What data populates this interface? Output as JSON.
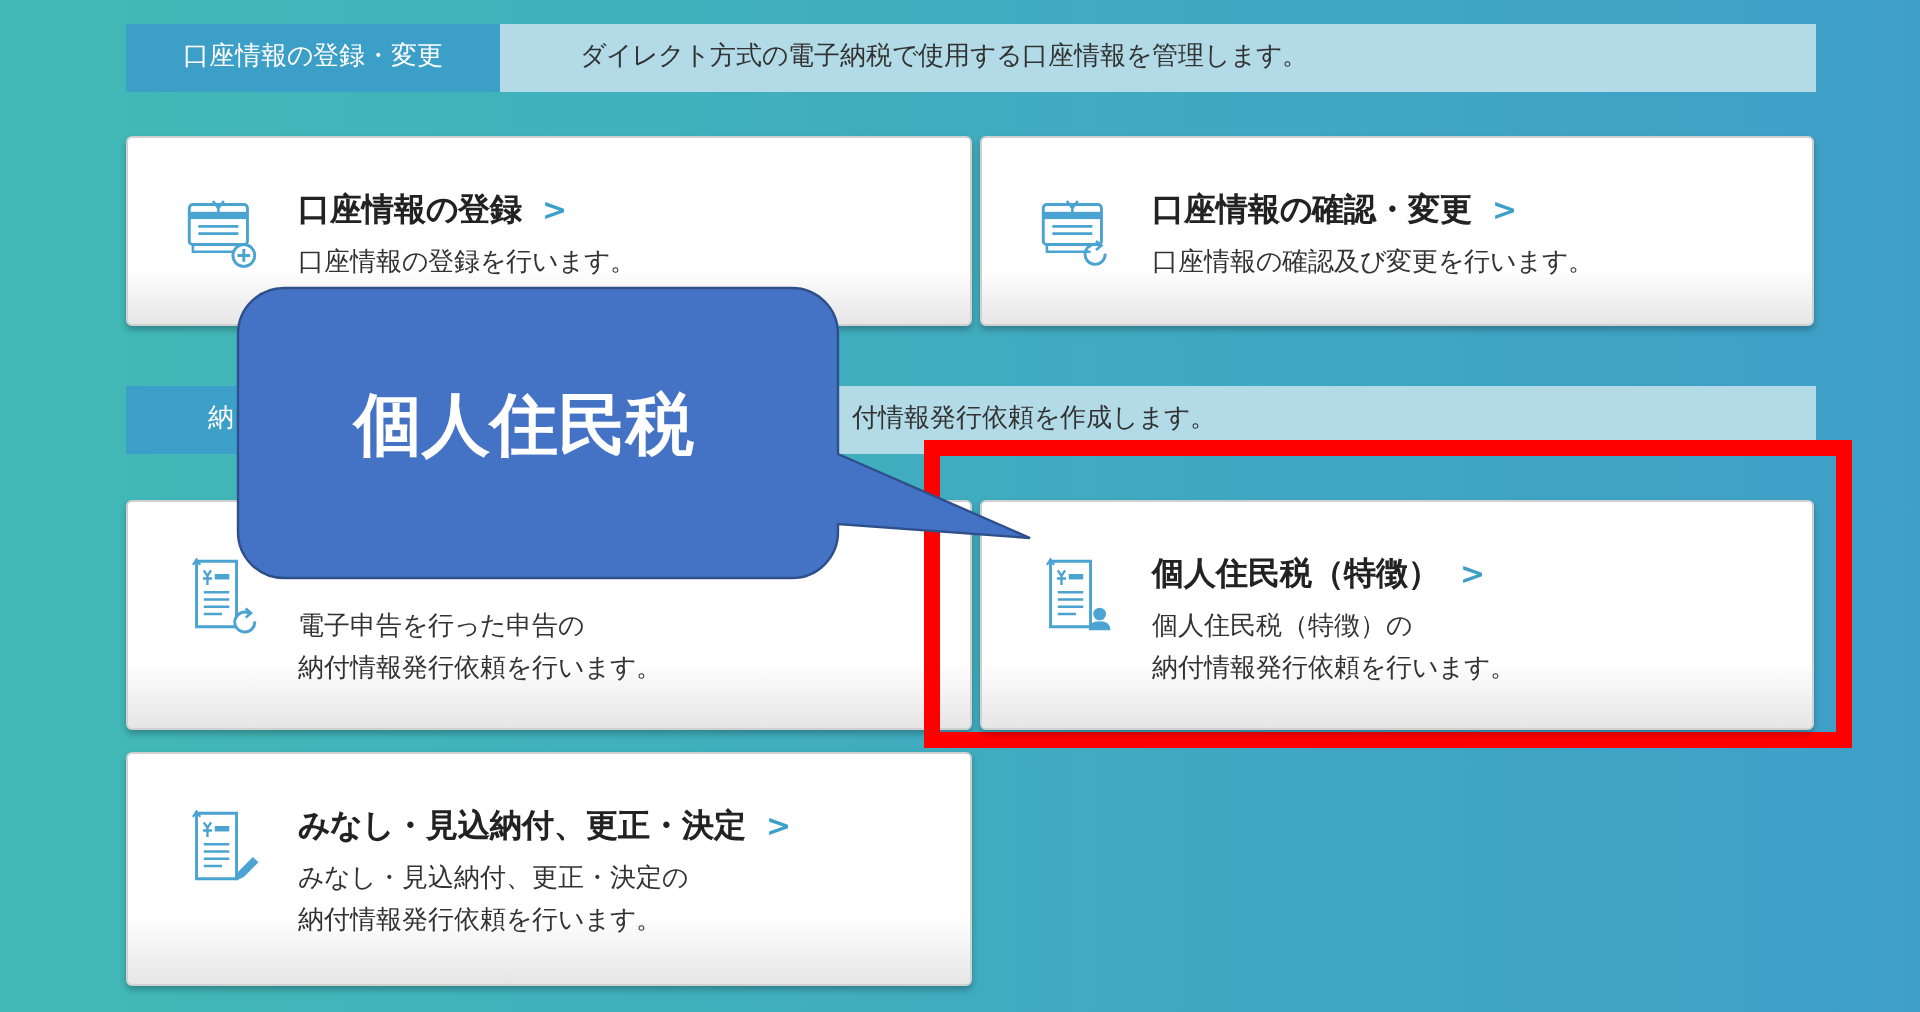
{
  "sections": [
    {
      "header": {
        "tab": "口座情報の登録・変更",
        "description": "ダイレクト方式の電子納税で使用する口座情報を管理します。"
      },
      "cards": [
        {
          "kind": "bank-add",
          "title": "口座情報の登録",
          "chevron": ">",
          "description": [
            "口座情報の登録を行います。"
          ],
          "highlighted": false
        },
        {
          "kind": "bank-refresh",
          "title": "口座情報の確認・変更",
          "chevron": ">",
          "description": [
            "口座情報の確認及び変更を行います。"
          ],
          "highlighted": false
        }
      ]
    },
    {
      "header": {
        "tab": "納",
        "description": "付情報発行依頼を作成します。"
      },
      "cards": [
        {
          "kind": "doc-refresh",
          "description": [
            "電子申告を行った申告の",
            "納付情報発行依頼を行います。"
          ],
          "highlighted": false
        },
        {
          "kind": "doc-person",
          "title": "個人住民税（特徴）",
          "chevron": ">",
          "description": [
            "個人住民税（特徴）の",
            "納付情報発行依頼を行います。"
          ],
          "highlighted": true
        },
        {
          "kind": "doc-pencil",
          "title": "みなし・見込納付、更正・決定",
          "chevron": ">",
          "description": [
            "みなし・見込納付、更正・決定の",
            "納付情報発行依頼を行います。"
          ],
          "highlighted": false
        }
      ]
    }
  ],
  "callout": {
    "text": "個人住民税"
  }
}
